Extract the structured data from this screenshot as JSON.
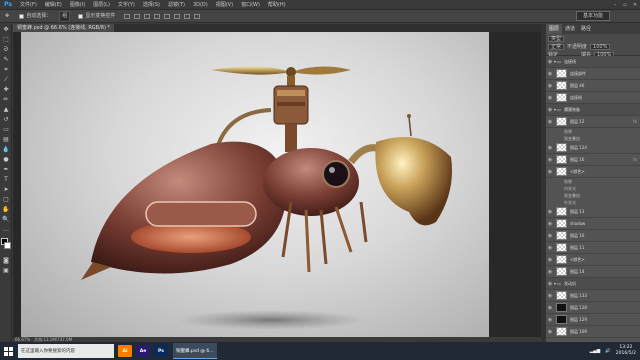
{
  "app": {
    "name": "Ps"
  },
  "menu": [
    "文件(F)",
    "编辑(E)",
    "图像(I)",
    "图层(L)",
    "文字(Y)",
    "选择(S)",
    "滤镜(T)",
    "3D(D)",
    "视图(V)",
    "窗口(W)",
    "帮助(H)"
  ],
  "options": {
    "auto_select_label": "自动选择：",
    "auto_select_value": "组",
    "show_transform_label": "显示变换控件",
    "workspace": "基本功能"
  },
  "document": {
    "tab_title": "铜蜜蜂.psd @ 66.6% (连接线, RGB/8) *",
    "zoom": "66.67%",
    "doc_size": "文档:13.1M/747.0M"
  },
  "panels": {
    "tabs": [
      "图层",
      "通道",
      "路径"
    ],
    "kind_label": "类型",
    "blend_mode": "正常",
    "opacity_label": "不透明度",
    "opacity_value": "100%",
    "lock_label": "锁定",
    "fill_label": "填充",
    "fill_value": "100%"
  },
  "layers": [
    {
      "name": "连接线",
      "type": "group"
    },
    {
      "name": "连接部件",
      "type": "layer"
    },
    {
      "name": "图层 46",
      "type": "layer"
    },
    {
      "name": "连接线",
      "type": "layer"
    },
    {
      "name": "翼膜装备",
      "type": "group"
    },
    {
      "name": "图层 12",
      "type": "layer",
      "fx": "fx"
    },
    {
      "name": "效果",
      "type": "effect"
    },
    {
      "name": "渐变叠加",
      "type": "effect"
    },
    {
      "name": "图层 124",
      "type": "layer"
    },
    {
      "name": "图层 16",
      "type": "layer",
      "fx": "fx"
    },
    {
      "name": "<颜色>",
      "type": "layer"
    },
    {
      "name": "效果",
      "type": "effect"
    },
    {
      "name": "内发光",
      "type": "effect"
    },
    {
      "name": "渐变叠加",
      "type": "effect"
    },
    {
      "name": "外发光",
      "type": "effect"
    },
    {
      "name": "图层 13",
      "type": "layer"
    },
    {
      "name": "shadow",
      "type": "layer"
    },
    {
      "name": "图层 10",
      "type": "layer"
    },
    {
      "name": "图层 11",
      "type": "layer"
    },
    {
      "name": "<颜色>",
      "type": "layer"
    },
    {
      "name": "图层 14",
      "type": "layer"
    },
    {
      "name": "发动机",
      "type": "group"
    },
    {
      "name": "图层 133",
      "type": "layer"
    },
    {
      "name": "图层 128",
      "type": "layer",
      "dark": true
    },
    {
      "name": "图层 129",
      "type": "layer",
      "dark": true
    },
    {
      "name": "图层 109",
      "type": "layer"
    },
    {
      "name": "螺旋桨部件",
      "type": "layer"
    },
    {
      "name": "图层 8",
      "type": "layer"
    },
    {
      "name": "图层 ...",
      "type": "layer"
    }
  ],
  "taskbar": {
    "search_placeholder": "在这里输入你要搜索的内容",
    "apps": [
      "Ai",
      "Ae",
      "Ps"
    ],
    "active_window": "铜蜜蜂.psd @ 6...",
    "time": "13:22",
    "date": "2016/5/2"
  }
}
